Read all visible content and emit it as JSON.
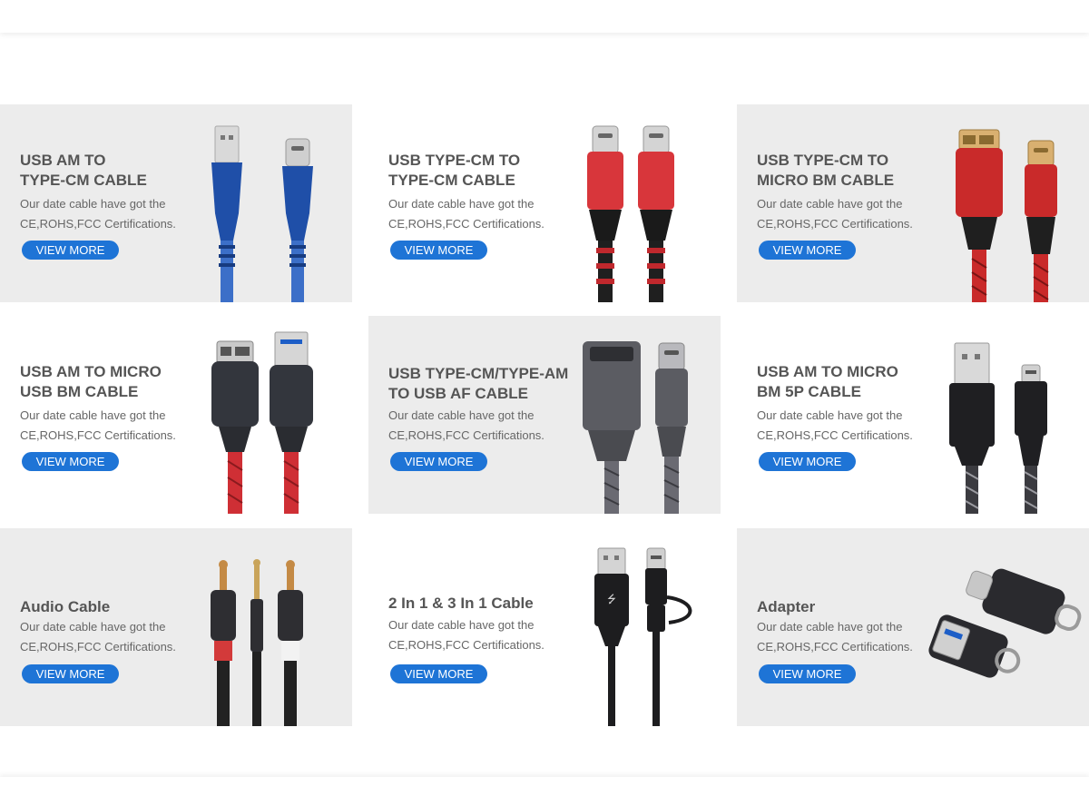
{
  "products": [
    {
      "title_line1": "USB AM TO",
      "title_line2": "TYPE-CM CABLE",
      "desc_line1": "Our date cable have got the",
      "desc_line2": "CE,ROHS,FCC Certifications.",
      "button": "VIEW MORE",
      "cable_color": "#1f4fa8"
    },
    {
      "title_line1": "USB TYPE-CM TO",
      "title_line2": "TYPE-CM CABLE",
      "desc_line1": "Our date cable have got the",
      "desc_line2": "CE,ROHS,FCC Certifications.",
      "button": "VIEW MORE",
      "cable_color": "#d8363b"
    },
    {
      "title_line1": "USB TYPE-CM TO",
      "title_line2": "MICRO BM CABLE",
      "desc_line1": "Our date cable have got the",
      "desc_line2": "CE,ROHS,FCC Certifications.",
      "button": "VIEW MORE",
      "cable_color": "#c92a2a"
    },
    {
      "title_line1": "USB AM TO MICRO",
      "title_line2": "USB BM CABLE",
      "desc_line1": "Our date cable have got the",
      "desc_line2": "CE,ROHS,FCC Certifications.",
      "button": "VIEW MORE",
      "cable_color": "#cf2f35"
    },
    {
      "title_line1": "USB TYPE-CM/TYPE-AM",
      "title_line2": "TO USB AF CABLE",
      "desc_line1": "Our date cable have got the",
      "desc_line2": "CE,ROHS,FCC Certifications.",
      "button": "VIEW MORE",
      "cable_color": "#6a6a72"
    },
    {
      "title_line1": "USB AM TO MICRO",
      "title_line2": "BM 5P CABLE",
      "desc_line1": "Our date cable have got the",
      "desc_line2": "CE,ROHS,FCC Certifications.",
      "button": "VIEW MORE",
      "cable_color": "#333338"
    },
    {
      "title_line1": "Audio Cable",
      "desc_line1": "Our date cable have got the",
      "desc_line2": "CE,ROHS,FCC Certifications.",
      "button": "VIEW MORE",
      "cable_color": "#222222"
    },
    {
      "title_line1": "2 In 1 & 3 In 1 Cable",
      "desc_line1": "Our date cable have got the",
      "desc_line2": "CE,ROHS,FCC Certifications.",
      "button": "VIEW MORE",
      "cable_color": "#1d1d1f"
    },
    {
      "title_line1": "Adapter",
      "desc_line1": "Our date cable have got the",
      "desc_line2": "CE,ROHS,FCC Certifications.",
      "button": "VIEW MORE",
      "cable_color": "#2a2a2e"
    }
  ],
  "colors": {
    "button_bg": "#1e74d6",
    "button_text": "#ffffff",
    "title_text": "#555555",
    "desc_text": "#666666",
    "card_gray": "#ececec"
  }
}
